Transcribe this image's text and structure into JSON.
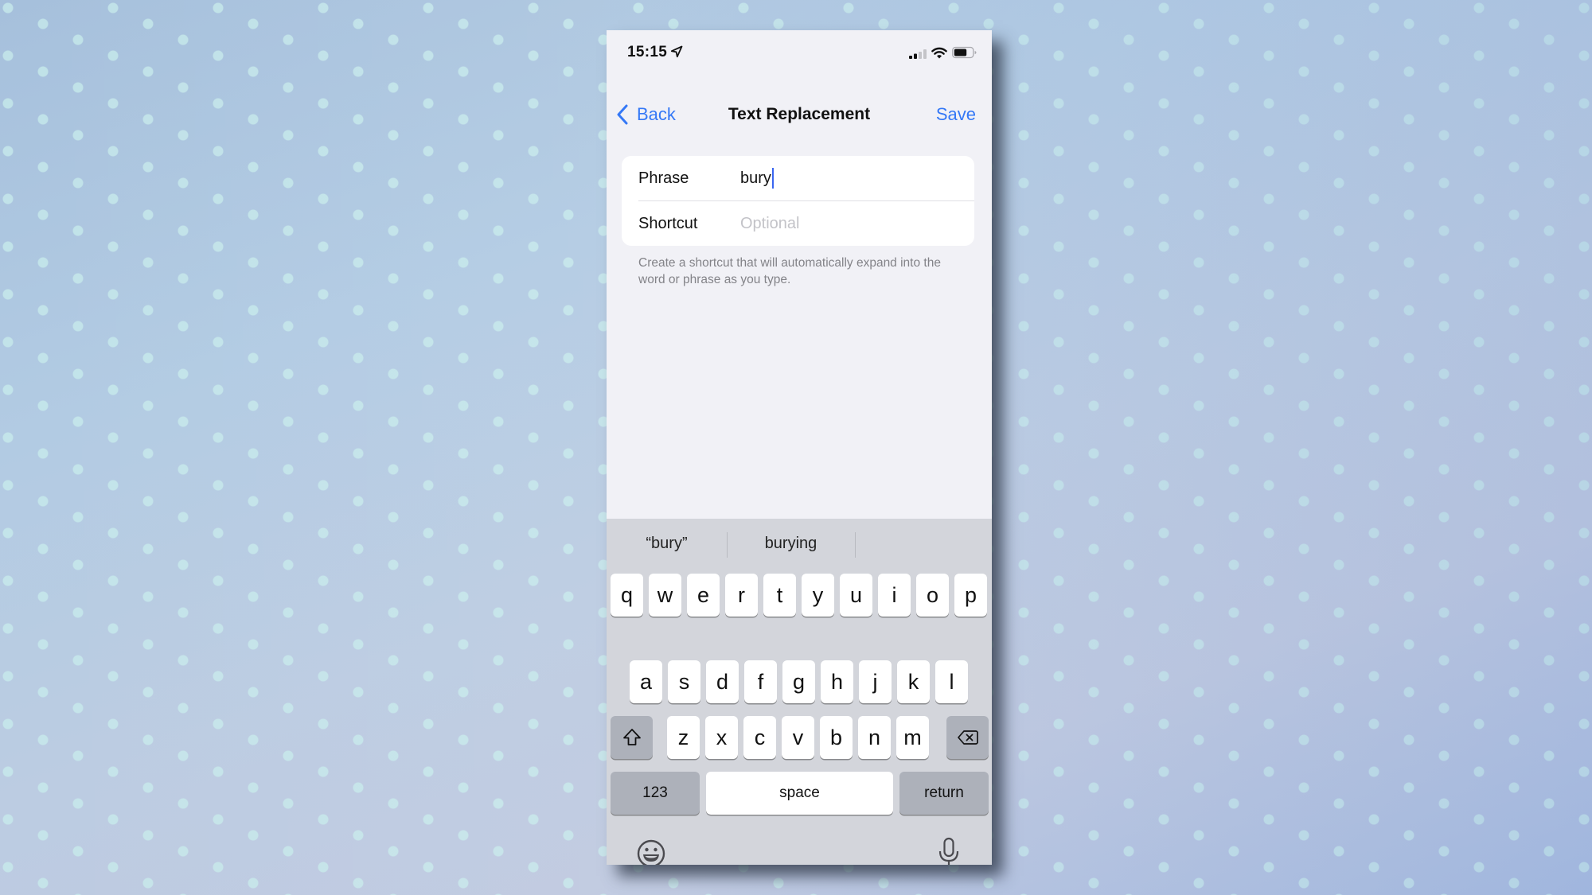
{
  "background": {
    "base_color": "#b3c8e0",
    "dot_color": "#c8ecec"
  },
  "status_bar": {
    "time": "15:15",
    "location_icon": "location-arrow-icon",
    "signal_icon": "cellular-signal-icon",
    "signal_bars_active": 2,
    "signal_bars_total": 4,
    "wifi_icon": "wifi-icon",
    "battery_icon": "battery-icon",
    "battery_level": 0.7
  },
  "nav": {
    "back_label": "Back",
    "back_icon": "chevron-left-icon",
    "title": "Text Replacement",
    "save_label": "Save",
    "accent_color": "#3478f6"
  },
  "form": {
    "phrase": {
      "label": "Phrase",
      "value": "bury",
      "placeholder": ""
    },
    "shortcut": {
      "label": "Shortcut",
      "value": "",
      "placeholder": "Optional"
    },
    "helper_text": "Create a shortcut that will automatically expand into the word or phrase as you type."
  },
  "keyboard": {
    "suggestions": [
      "“bury”",
      "burying",
      ""
    ],
    "rows": [
      [
        "q",
        "w",
        "e",
        "r",
        "t",
        "y",
        "u",
        "i",
        "o",
        "p"
      ],
      [
        "a",
        "s",
        "d",
        "f",
        "g",
        "h",
        "j",
        "k",
        "l"
      ],
      [
        "z",
        "x",
        "c",
        "v",
        "b",
        "n",
        "m"
      ]
    ],
    "shift_icon": "shift-icon",
    "delete_icon": "delete-backspace-icon",
    "numbers_label": "123",
    "space_label": "space",
    "return_label": "return",
    "emoji_icon": "emoji-icon",
    "mic_icon": "microphone-icon"
  }
}
